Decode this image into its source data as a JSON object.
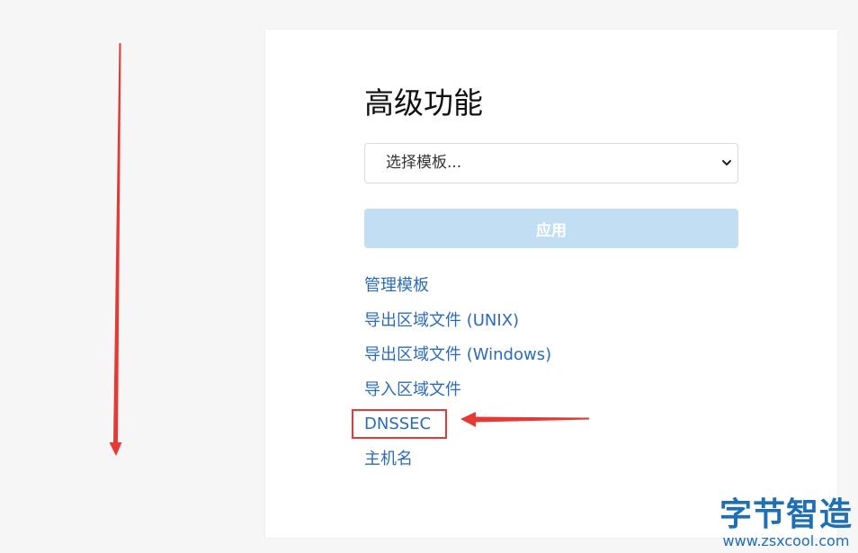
{
  "page": {
    "title": "高级功能"
  },
  "template_select": {
    "value": "选择模板..."
  },
  "apply_button": {
    "label": "应用"
  },
  "links": [
    {
      "label": "管理模板"
    },
    {
      "label": "导出区域文件 (UNIX)"
    },
    {
      "label": "导出区域文件 (Windows)"
    },
    {
      "label": "导入区域文件"
    },
    {
      "label": "DNSSEC"
    },
    {
      "label": "主机名"
    }
  ],
  "watermark": {
    "logo_text": "字节智造",
    "url": "www.zsxcool.com"
  },
  "colors": {
    "link": "#2b6cb8",
    "apply_button_disabled": "#c2def2",
    "annotation_red": "#e53935",
    "watermark_blue": "#1f6fb5"
  },
  "icons": {
    "select_indicator": "chevron-down-icon",
    "annotations": [
      "down-arrow-annotation",
      "left-arrow-annotation"
    ]
  }
}
